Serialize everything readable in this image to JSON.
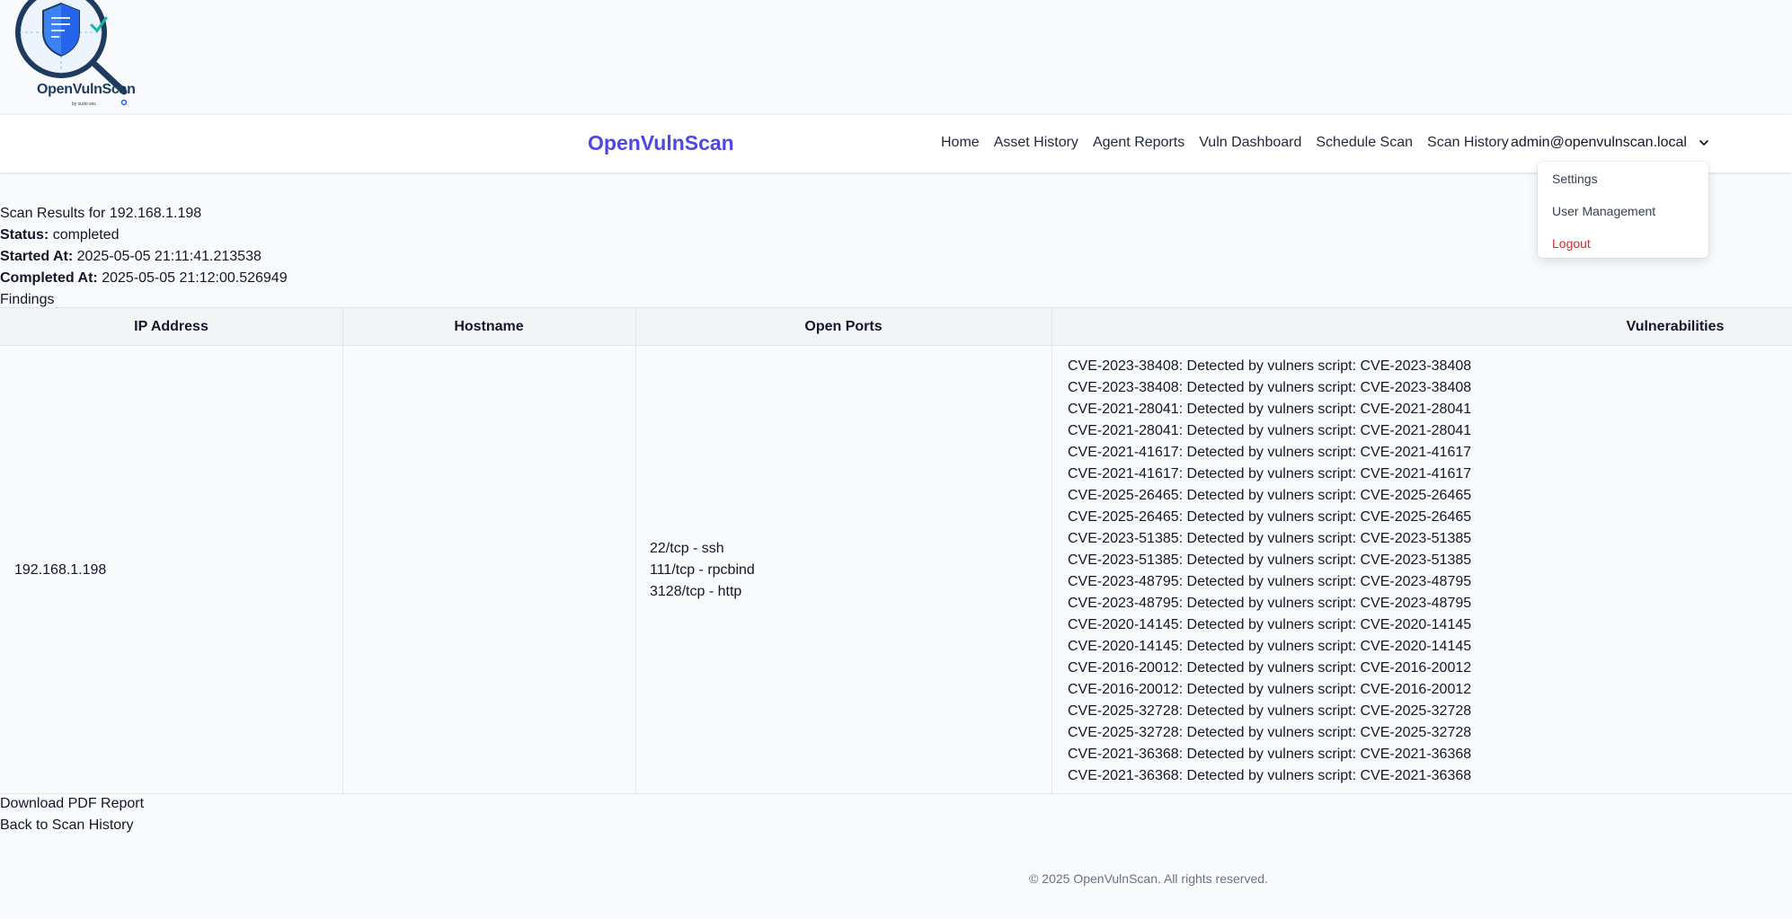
{
  "logo": {
    "name": "OpenVulnScan",
    "tagline": "by sudo-sec"
  },
  "navbar": {
    "brand": "OpenVulnScan",
    "links": [
      "Home",
      "Asset History",
      "Agent Reports",
      "Vuln Dashboard",
      "Schedule Scan",
      "Scan History"
    ],
    "user_email": "admin@openvulnscan.local"
  },
  "user_dropdown": {
    "items": [
      "Settings",
      "User Management",
      "Logout"
    ]
  },
  "scan": {
    "title": "Scan Results for 192.168.1.198",
    "status_label": "Status:",
    "status": "completed",
    "started_label": "Started At:",
    "started_at": "2025-05-05 21:11:41.213538",
    "completed_label": "Completed At:",
    "completed_at": "2025-05-05 21:12:00.526949",
    "findings_heading": "Findings"
  },
  "findings_table": {
    "columns": [
      "IP Address",
      "Hostname",
      "Open Ports",
      "Vulnerabilities"
    ],
    "rows": [
      {
        "ip": "192.168.1.198",
        "hostname": "",
        "ports": [
          "22/tcp - ssh",
          "111/tcp - rpcbind",
          "3128/tcp - http"
        ],
        "vulnerabilities": [
          "CVE-2023-38408: Detected by vulners script: CVE-2023-38408",
          "CVE-2023-38408: Detected by vulners script: CVE-2023-38408",
          "CVE-2021-28041: Detected by vulners script: CVE-2021-28041",
          "CVE-2021-28041: Detected by vulners script: CVE-2021-28041",
          "CVE-2021-41617: Detected by vulners script: CVE-2021-41617",
          "CVE-2021-41617: Detected by vulners script: CVE-2021-41617",
          "CVE-2025-26465: Detected by vulners script: CVE-2025-26465",
          "CVE-2025-26465: Detected by vulners script: CVE-2025-26465",
          "CVE-2023-51385: Detected by vulners script: CVE-2023-51385",
          "CVE-2023-51385: Detected by vulners script: CVE-2023-51385",
          "CVE-2023-48795: Detected by vulners script: CVE-2023-48795",
          "CVE-2023-48795: Detected by vulners script: CVE-2023-48795",
          "CVE-2020-14145: Detected by vulners script: CVE-2020-14145",
          "CVE-2020-14145: Detected by vulners script: CVE-2020-14145",
          "CVE-2016-20012: Detected by vulners script: CVE-2016-20012",
          "CVE-2016-20012: Detected by vulners script: CVE-2016-20012",
          "CVE-2025-32728: Detected by vulners script: CVE-2025-32728",
          "CVE-2025-32728: Detected by vulners script: CVE-2025-32728",
          "CVE-2021-36368: Detected by vulners script: CVE-2021-36368",
          "CVE-2021-36368: Detected by vulners script: CVE-2021-36368"
        ]
      }
    ]
  },
  "actions": {
    "download_pdf": "Download PDF Report",
    "back_to_history": "Back to Scan History"
  },
  "footer": {
    "copyright": "© 2025 OpenVulnScan. All rights reserved."
  },
  "colors": {
    "brand": "#4f46e5",
    "logout": "#dc2626",
    "background": "#f8fafc",
    "logo_shield": "#3b82f6",
    "logo_check": "#14b8a6"
  },
  "icons": {
    "logo": "magnifier-shield-icon",
    "user_menu": "chevron-down-icon"
  }
}
